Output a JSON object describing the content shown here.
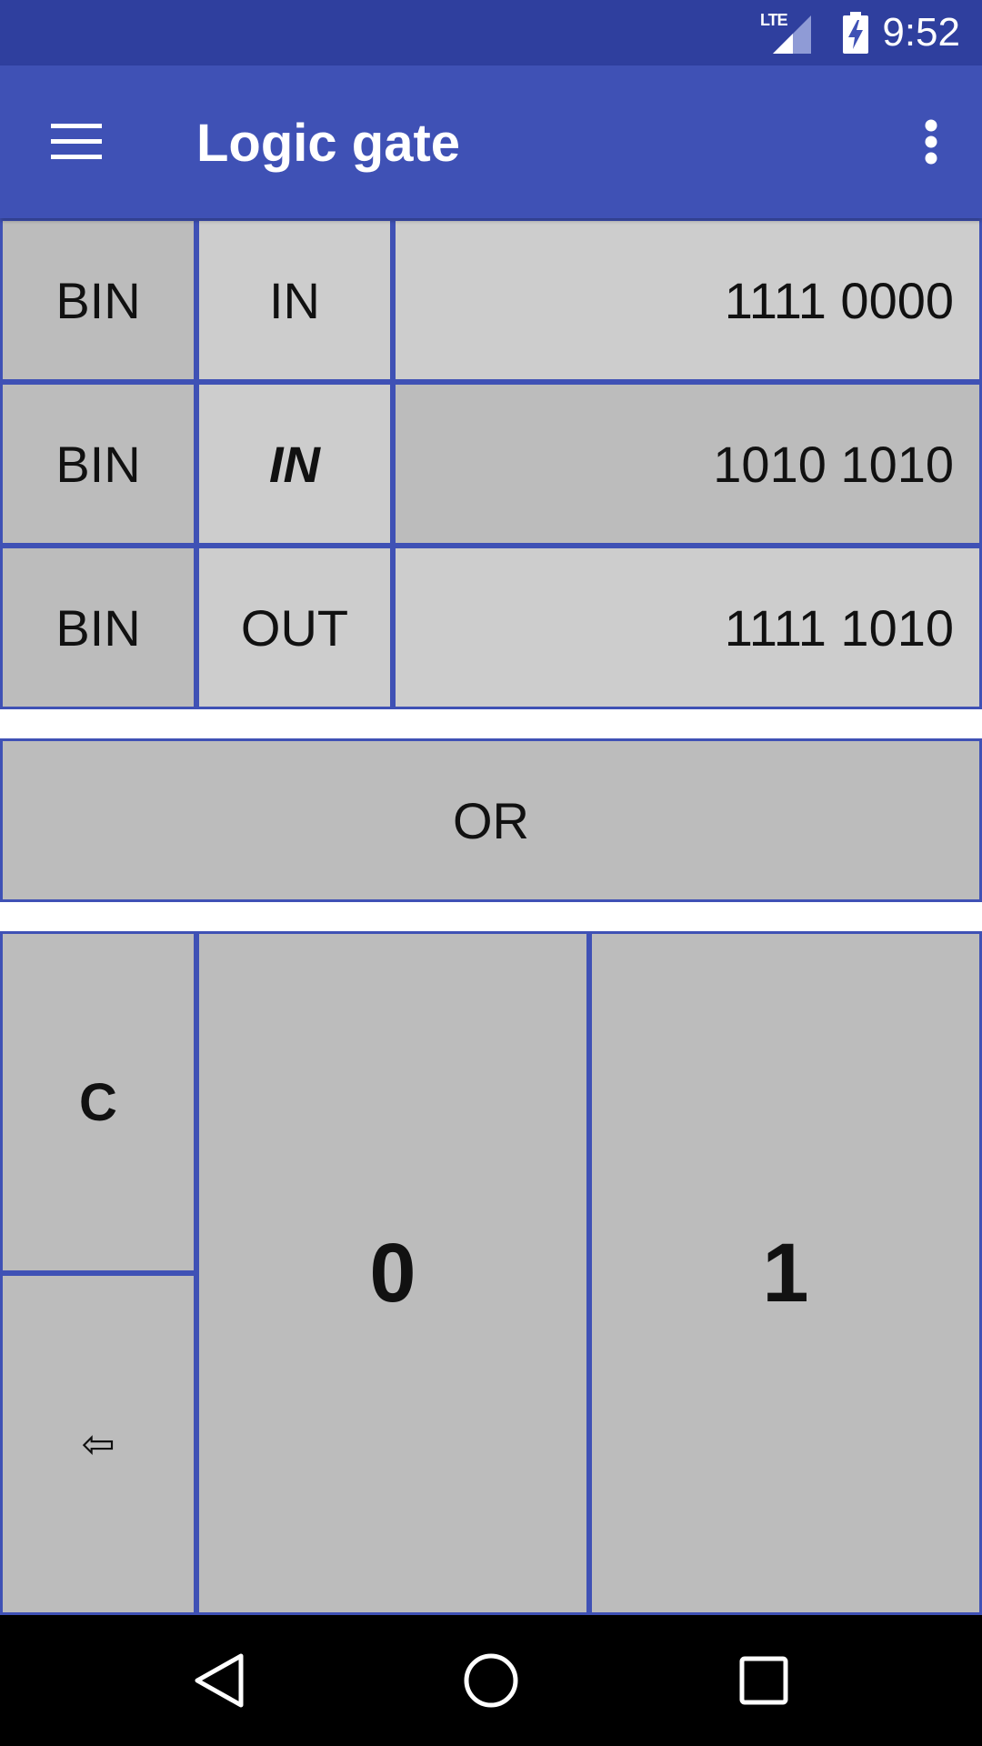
{
  "status_bar": {
    "network_label": "LTE",
    "time": "9:52",
    "icons": [
      "signal-icon",
      "battery-charging-icon"
    ]
  },
  "app_bar": {
    "title": "Logic gate",
    "icons": [
      "menu-icon",
      "more-vertical-icon"
    ]
  },
  "registers": [
    {
      "base": "BIN",
      "role": "IN",
      "value": "1111 0000"
    },
    {
      "base": "BIN",
      "role": "IN",
      "value": "1010 1010",
      "role_style": "bold italic"
    },
    {
      "base": "BIN",
      "role": "OUT",
      "value": "1111 1010"
    }
  ],
  "operation": {
    "label": "OR"
  },
  "keypad": {
    "clear_label": "C",
    "backspace_label": "⇦",
    "zero_label": "0",
    "one_label": "1"
  },
  "nav_bar": {
    "icons": [
      "back-icon",
      "home-icon",
      "recents-icon"
    ]
  },
  "colors": {
    "status_bar": "#2f3f9e",
    "app_bar": "#3f51b5",
    "cell_border": "#3f51b5",
    "cell_dark": "#bcbcbc",
    "cell_light": "#cdcdcd",
    "nav_bar": "#000000"
  }
}
